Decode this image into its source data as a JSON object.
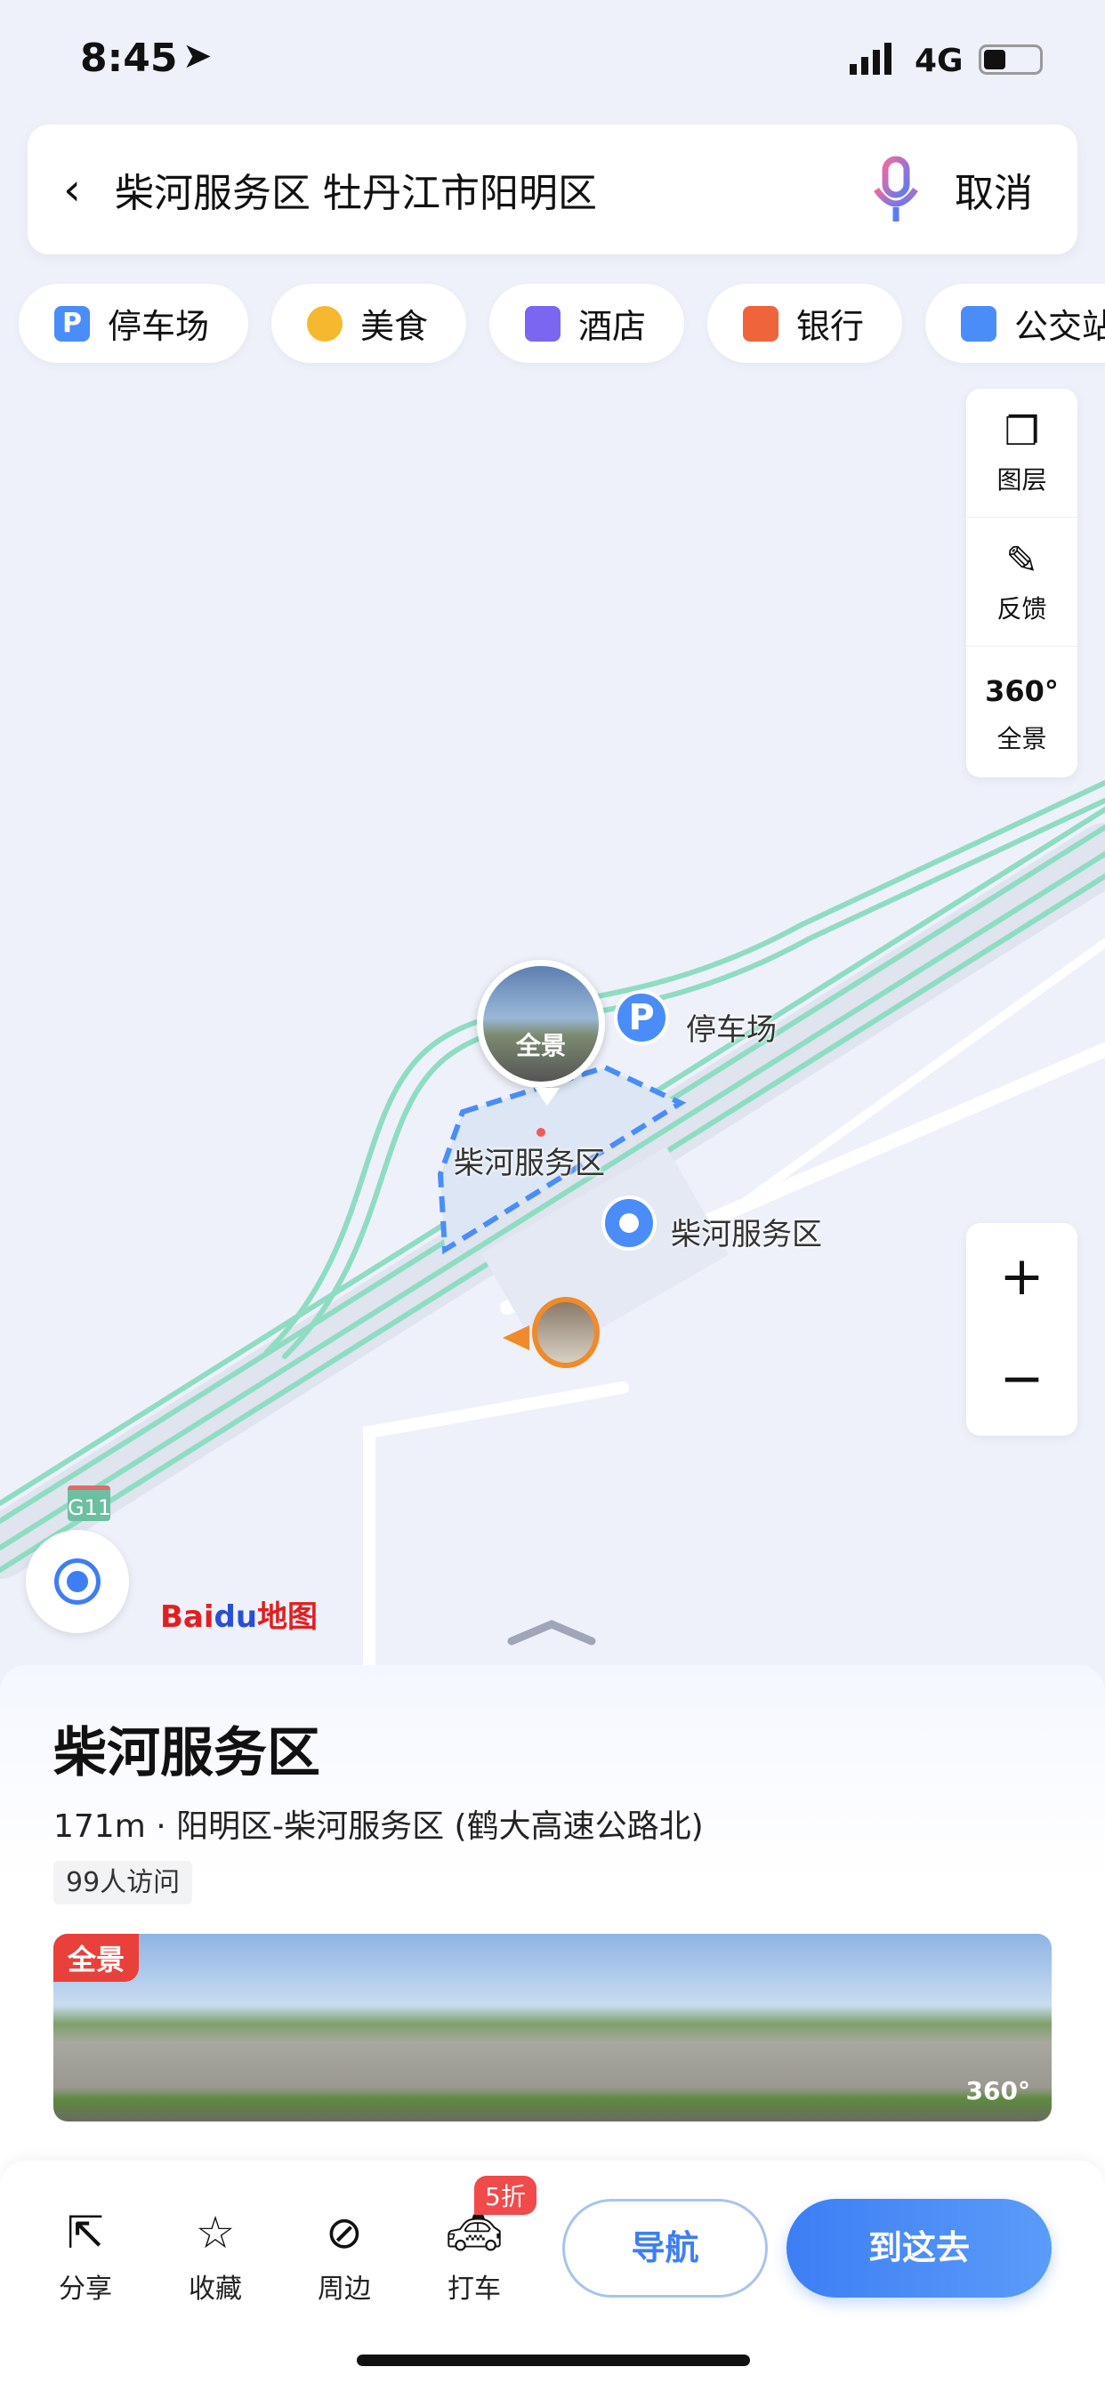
{
  "status_bar": {
    "time": "8:45",
    "network": "4G"
  },
  "search": {
    "query": "柴河服务区 牡丹江市阳明区",
    "cancel": "取消"
  },
  "categories": [
    {
      "label": "停车场",
      "icon": "parking-icon",
      "color": "#4a8df8"
    },
    {
      "label": "美食",
      "icon": "food-icon",
      "color": "#f5b82e"
    },
    {
      "label": "酒店",
      "icon": "hotel-icon",
      "color": "#7a66f0"
    },
    {
      "label": "银行",
      "icon": "bank-icon",
      "color": "#f0643c"
    },
    {
      "label": "公交站",
      "icon": "bus-stop-icon",
      "color": "#4a8df8"
    }
  ],
  "tools": [
    {
      "label": "图层",
      "icon": "layers-icon"
    },
    {
      "label": "反馈",
      "icon": "feedback-icon"
    },
    {
      "label": "全景",
      "icon": "panorama-360-icon",
      "glyph": "360°"
    }
  ],
  "map": {
    "panorama_label": "全景",
    "parking_label": "停车场",
    "area_label": "柴河服务区",
    "poi_label": "柴河服务区",
    "highway_shield": "G11",
    "logo": "Baidu地图"
  },
  "place": {
    "name": "柴河服务区",
    "address": "171m · 阳明区-柴河服务区 (鹤大高速公路北)",
    "visits": "99人访问",
    "photo_badge": "全景",
    "photo_360": "360°"
  },
  "actions": [
    {
      "label": "分享",
      "icon": "share-icon"
    },
    {
      "label": "收藏",
      "icon": "star-icon"
    },
    {
      "label": "周边",
      "icon": "compass-icon"
    },
    {
      "label": "打车",
      "icon": "taxi-icon",
      "badge": "5折"
    }
  ],
  "buttons": {
    "navigate": "导航",
    "go_here": "到这去"
  },
  "colors": {
    "accent": "#3d7ef5",
    "road": "#8fdcc3"
  }
}
